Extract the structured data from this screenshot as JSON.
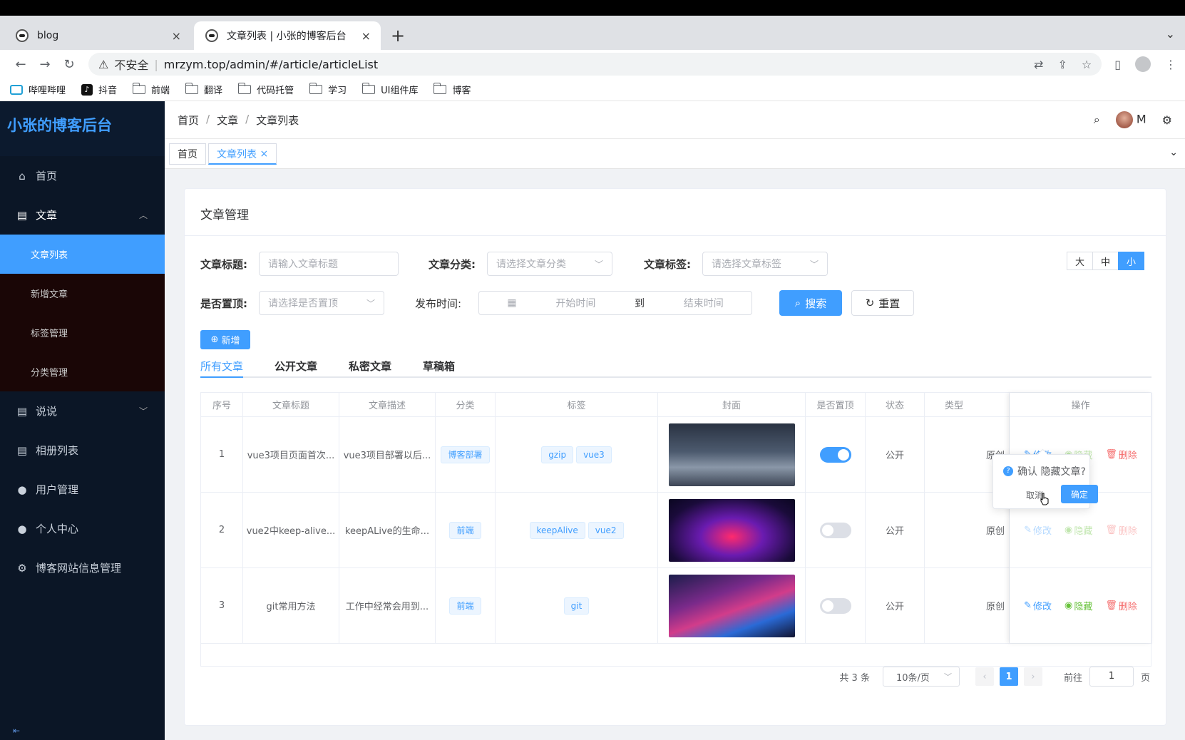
{
  "browser": {
    "tabs": [
      {
        "title": "blog",
        "close": "×"
      },
      {
        "title": "文章列表 | 小张的博客后台",
        "close": "×"
      }
    ],
    "new_tab": "+",
    "security_label": "不安全",
    "url": "mrzym.top/admin/#/article/articleList",
    "bookmarks": [
      "哔哩哔哩",
      "抖音",
      "前端",
      "翻译",
      "代码托管",
      "学习",
      "UI组件库",
      "博客"
    ]
  },
  "sidebar": {
    "logo": "小张的博客后台",
    "items": [
      {
        "label": "首页",
        "icon": "home-icon"
      },
      {
        "label": "文章",
        "icon": "clipboard-icon",
        "expanded": true
      },
      {
        "label": "说说",
        "icon": "clipboard-icon"
      },
      {
        "label": "相册列表",
        "icon": "clipboard-icon"
      },
      {
        "label": "用户管理",
        "icon": "user-icon"
      },
      {
        "label": "个人中心",
        "icon": "user-icon"
      },
      {
        "label": "博客网站信息管理",
        "icon": "gear-icon"
      }
    ],
    "subitems": [
      "文章列表",
      "新增文章",
      "标签管理",
      "分类管理"
    ]
  },
  "header": {
    "breadcrumb": [
      "首页",
      "文章",
      "文章列表"
    ],
    "username": "M"
  },
  "tags_view": [
    {
      "label": "首页"
    },
    {
      "label": "文章列表",
      "close": "×",
      "active": true
    }
  ],
  "card": {
    "title": "文章管理",
    "filters": {
      "title_label": "文章标题:",
      "title_placeholder": "请输入文章标题",
      "category_label": "文章分类:",
      "category_placeholder": "请选择文章分类",
      "tag_label": "文章标签:",
      "tag_placeholder": "请选择文章标签",
      "top_label": "是否置顶:",
      "top_placeholder": "请选择是否置顶",
      "time_label": "发布时间:",
      "start_placeholder": "开始时间",
      "range_sep": "到",
      "end_placeholder": "结束时间",
      "search": "搜索",
      "reset": "重置"
    },
    "sizes": [
      "大",
      "中",
      "小"
    ],
    "active_size": "小",
    "new_button": "新增",
    "tabs": [
      "所有文章",
      "公开文章",
      "私密文章",
      "草稿箱"
    ],
    "active_tab": "所有文章"
  },
  "table": {
    "columns": [
      "序号",
      "文章标题",
      "文章描述",
      "分类",
      "标签",
      "封面",
      "是否置顶",
      "状态",
      "类型",
      "操作"
    ],
    "rows": [
      {
        "no": "1",
        "title": "vue3项目页面首次...",
        "desc": "vue3项目部署以后...",
        "category": "博客部署",
        "tags": [
          "gzip",
          "vue3"
        ],
        "top": true,
        "status": "公开",
        "type": "原创"
      },
      {
        "no": "2",
        "title": "vue2中keep-alive...",
        "desc": "keepALive的生命...",
        "category": "前端",
        "tags": [
          "keepAlive",
          "vue2"
        ],
        "top": false,
        "status": "公开",
        "type": "原创"
      },
      {
        "no": "3",
        "title": "git常用方法",
        "desc": "工作中经常会用到...",
        "category": "前端",
        "tags": [
          "git"
        ],
        "top": false,
        "status": "公开",
        "type": "原创"
      }
    ],
    "actions": {
      "edit": "修改",
      "hide": "隐藏",
      "delete": "删除"
    }
  },
  "popconfirm": {
    "message": "确认 隐藏文章?",
    "cancel": "取消",
    "confirm": "确定"
  },
  "pagination": {
    "total": "共 3 条",
    "page_size": "10条/页",
    "current": "1",
    "goto_label": "前往",
    "goto_value": "1",
    "page_suffix": "页"
  },
  "colors": {
    "primary": "#409eff",
    "sidebar": "#0b1626",
    "success": "#67c23a",
    "danger": "#f56c6c"
  }
}
